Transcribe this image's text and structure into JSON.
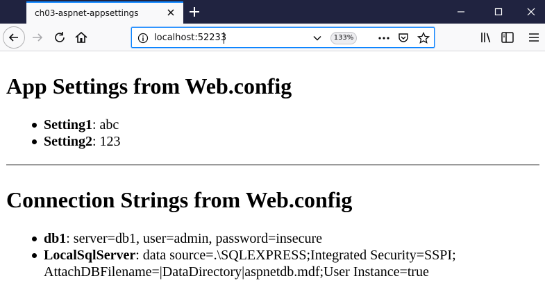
{
  "browser": {
    "tab_title": "ch03-aspnet-appsettings",
    "url": "localhost:52233",
    "zoom": "133%"
  },
  "page": {
    "app_settings_heading": "App Settings from Web.config",
    "app_settings": [
      {
        "key": "Setting1",
        "value": ": abc"
      },
      {
        "key": "Setting2",
        "value": ": 123"
      }
    ],
    "conn_heading": "Connection Strings from Web.config",
    "conn_strings": [
      {
        "key": "db1",
        "value": ": server=db1, user=admin, password=insecure"
      },
      {
        "key": "LocalSqlServer",
        "value": ": data source=.\\SQLEXPRESS;Integrated Security=SSPI;",
        "value2": "AttachDBFilename=|DataDirectory|aspnetdb.mdf;User Instance=true"
      }
    ]
  }
}
